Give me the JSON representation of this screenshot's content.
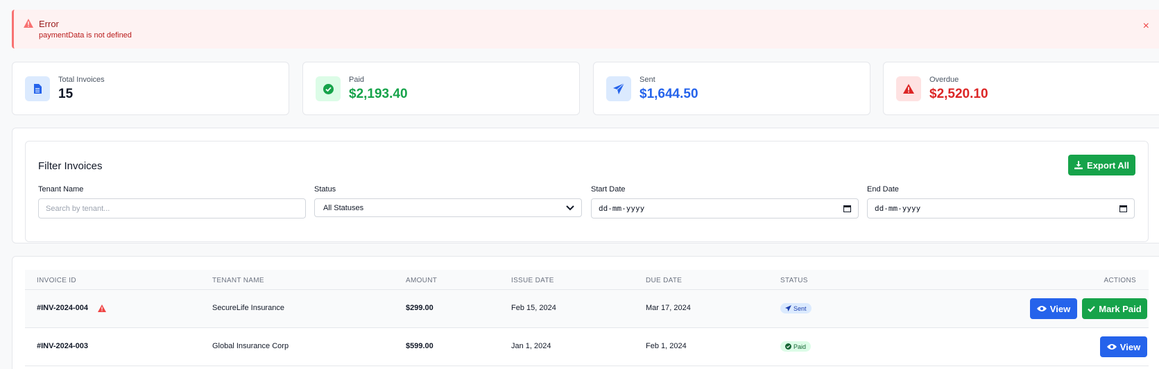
{
  "error": {
    "title": "Error",
    "message": "paymentData is not defined",
    "close": "×"
  },
  "stats": [
    {
      "label": "Total Invoices",
      "value": "15",
      "color": "#111827",
      "icon": "document-icon",
      "icon_bg": "#dbeafe"
    },
    {
      "label": "Paid",
      "value": "$2,193.40",
      "color": "#16a34a",
      "icon": "check-circle-icon",
      "icon_bg": "#dcfce7"
    },
    {
      "label": "Sent",
      "value": "$1,644.50",
      "color": "#2563eb",
      "icon": "paper-plane-icon",
      "icon_bg": "#dbeafe"
    },
    {
      "label": "Overdue",
      "value": "$2,520.10",
      "color": "#dc2626",
      "icon": "warning-icon",
      "icon_bg": "#fee2e2"
    }
  ],
  "filter": {
    "title": "Filter Invoices",
    "export_label": "Export All",
    "tenant": {
      "label": "Tenant Name",
      "placeholder": "Search by tenant..."
    },
    "status": {
      "label": "Status",
      "value": "All Statuses"
    },
    "start_date": {
      "label": "Start Date",
      "value": "dd-mm-yyyy"
    },
    "end_date": {
      "label": "End Date",
      "value": "dd-mm-yyyy"
    }
  },
  "table": {
    "columns": [
      "INVOICE ID",
      "TENANT NAME",
      "AMOUNT",
      "ISSUE DATE",
      "DUE DATE",
      "STATUS",
      "ACTIONS"
    ],
    "rows": [
      {
        "id": "#INV-2024-004",
        "tenant": "SecureLife Insurance",
        "amount": "$299.00",
        "issue": "Feb 15, 2024",
        "due": "Mar 17, 2024",
        "status": "Sent",
        "view": "View",
        "mark_paid": "Mark Paid"
      },
      {
        "id": "#INV-2024-003",
        "tenant": "Global Insurance Corp",
        "amount": "$599.00",
        "issue": "Jan 1, 2024",
        "due": "Feb 1, 2024",
        "status": "Paid",
        "view": "View"
      }
    ]
  },
  "colors": {
    "primary": "#2563eb",
    "success": "#16a34a",
    "danger": "#dc2626"
  }
}
